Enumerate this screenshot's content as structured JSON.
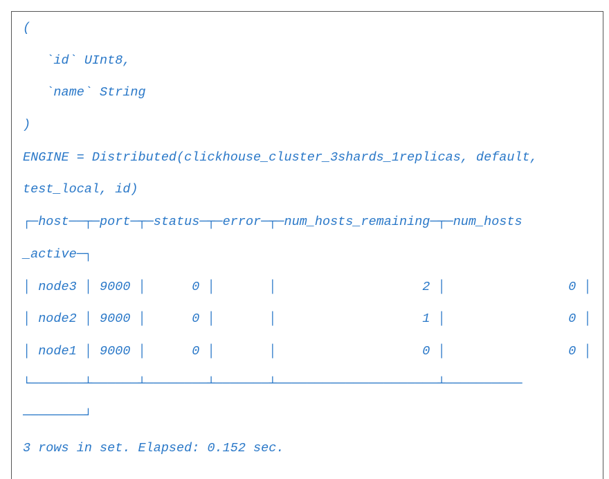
{
  "lines": [
    "(",
    "   `id` UInt8,",
    "   `name` String",
    ")",
    "ENGINE = Distributed(clickhouse_cluster_3shards_1replicas, default,",
    "test_local, id)",
    "┌─host──┬─port─┬─status─┬─error─┬─num_hosts_remaining─┬─num_hosts",
    "_active─┐",
    "│ node3 │ 9000 │      0 │       │                   2 │                0 │",
    "│ node2 │ 9000 │      0 │       │                   1 │                0 │",
    "│ node1 │ 9000 │      0 │       │                   0 │                0 │",
    "└───────┴──────┴────────┴───────┴─────────────────────┴──────────",
    "────────┘",
    "3 rows in set. Elapsed: 0.152 sec."
  ],
  "colors": {
    "text": "#2a78c8",
    "border": "#555555"
  }
}
